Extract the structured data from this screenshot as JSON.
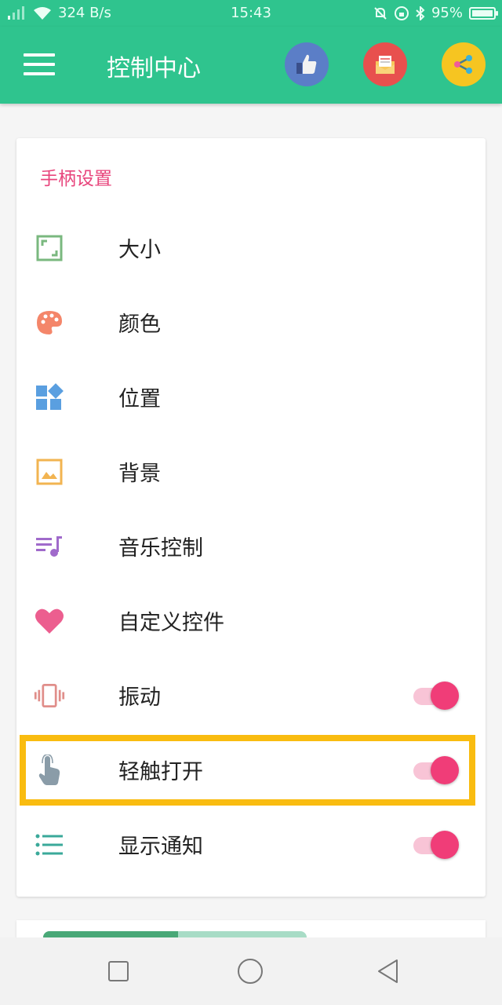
{
  "status_bar": {
    "net_speed": "324 B/s",
    "time": "15:43",
    "battery": "95%",
    "icons": [
      "signal-icon",
      "wifi-icon",
      "mute-icon",
      "lock-rotation-icon",
      "bluetooth-icon",
      "battery-icon"
    ]
  },
  "app_bar": {
    "title": "控制中心",
    "buttons": [
      "thumbs-up-icon",
      "mail-icon",
      "share-icon"
    ],
    "colors": {
      "bar": "#2fc48e",
      "like": "#5b7ec7",
      "mail": "#e8504e",
      "share": "#f6c521"
    }
  },
  "card": {
    "section_title": "手柄设置",
    "items": [
      {
        "label": "大小",
        "icon": "resize-icon"
      },
      {
        "label": "颜色",
        "icon": "palette-icon"
      },
      {
        "label": "位置",
        "icon": "widgets-icon"
      },
      {
        "label": "背景",
        "icon": "image-icon"
      },
      {
        "label": "音乐控制",
        "icon": "music-list-icon"
      },
      {
        "label": "自定义控件",
        "icon": "heart-icon"
      },
      {
        "label": "振动",
        "icon": "vibrate-icon",
        "toggle": true,
        "on": true
      },
      {
        "label": "轻触打开",
        "icon": "touch-icon",
        "toggle": true,
        "on": true
      },
      {
        "label": "显示通知",
        "icon": "list-icon",
        "toggle": true,
        "on": true
      }
    ]
  },
  "accent_colors": {
    "section": "#e8457c",
    "toggle_on": "#f03d78",
    "highlight": "#f9bc10"
  }
}
